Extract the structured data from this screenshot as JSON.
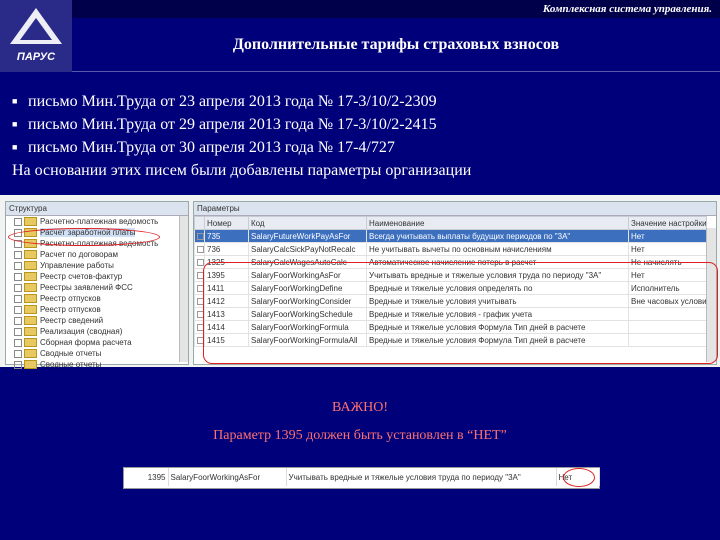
{
  "header": {
    "system_name": "Комплексная система управления.",
    "title": "Дополнительные тарифы страховых взносов",
    "logo_text": "ПАРУС"
  },
  "bullets": [
    "письмо Мин.Труда от 23 апреля 2013 года № 17-3/10/2-2309",
    "письмо Мин.Труда от 29 апреля 2013 года № 17-3/10/2-2415",
    "письмо Мин.Труда от 30 апреля 2013 года № 17-4/727"
  ],
  "note": "На основании этих писем были добавлены параметры организации",
  "tree": {
    "header": "Структура",
    "items": [
      "Расчетно-платежная ведомость",
      "Расчет заработной платы",
      "Расчетно-платежная ведомость",
      "Расчет по договорам",
      "Управление работы",
      "Реестр счетов-фактур",
      "Реестры заявлений ФСС",
      "Реестр отпусков",
      "Реестр отпусков",
      "Реестр сведений",
      "Реализация (сводная)",
      "Сборная форма расчета",
      "Сводные отчеты",
      "Сводные отчеты"
    ]
  },
  "grid": {
    "panel_title": "Параметры",
    "columns": [
      "",
      "Номер",
      "Код",
      "Наименование",
      "Значение настройки"
    ],
    "rows": [
      {
        "num": "735",
        "code": "SalaryFutureWorkPayAsFor",
        "name": "Всегда учитывать выплаты будущих периодов по \"3А\"",
        "value": "Нет",
        "selected": true
      },
      {
        "num": "736",
        "code": "SalaryCalcSickPayNotRecalc",
        "name": "Не учитывать вычеты по основным начислениям",
        "value": "Нет",
        "selected": false
      },
      {
        "num": "1325",
        "code": "SalaryCalcWagesAutoCalc",
        "name": "Автоматическое начисление потерь в расчет",
        "value": "Не начислять",
        "selected": false
      },
      {
        "num": "1395",
        "code": "SalaryFoorWorkingAsFor",
        "name": "Учитывать вредные и тяжелые условия труда по периоду \"3А\"",
        "value": "Нет",
        "selected": false
      },
      {
        "num": "1411",
        "code": "SalaryFoorWorkingDefine",
        "name": "Вредные и тяжелые условия определять по",
        "value": "Исполнитель",
        "selected": false
      },
      {
        "num": "1412",
        "code": "SalaryFoorWorkingConsider",
        "name": "Вредные и тяжелые условия учитывать",
        "value": "Вне часовых условиях",
        "selected": false
      },
      {
        "num": "1413",
        "code": "SalaryFoorWorkingSchedule",
        "name": "Вредные и тяжелые условия - график учета",
        "value": "",
        "selected": false
      },
      {
        "num": "1414",
        "code": "SalaryFoorWorkingFormula",
        "name": "Вредные и тяжелые условия Формула Тип дней в расчете",
        "value": "",
        "selected": false
      },
      {
        "num": "1415",
        "code": "SalaryFoorWorkingFormulaAll",
        "name": "Вредные и тяжелые условия Формула Тип дней в расчете",
        "value": "",
        "selected": false
      }
    ]
  },
  "important": {
    "title": "ВАЖНО!",
    "text": "Параметр 1395 должен быть установлен в “НЕТ”"
  },
  "strip": {
    "num": "1395",
    "code": "SalaryFoorWorkingAsFor",
    "name": "Учитывать вредные и тяжелые условия труда по периоду \"3А\"",
    "value": "Нет"
  }
}
